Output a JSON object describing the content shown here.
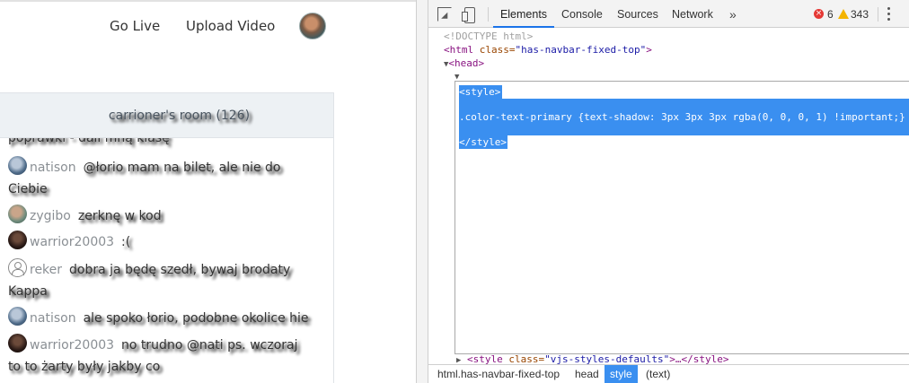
{
  "page": {
    "nav": {
      "go_live": "Go Live",
      "upload_video": "Upload Video"
    },
    "chat": {
      "title": "carrioner's room (126)",
      "cut_text": "poprawki - dali mną klasę",
      "messages": [
        {
          "user": "natison",
          "avatar": "photo",
          "text": "@łorio mam na bilet, ale nie do",
          "wrap": "Ciebie"
        },
        {
          "user": "zygibo",
          "avatar": "photo2",
          "text": "zerknę w kod",
          "wrap": ""
        },
        {
          "user": "warrior20003",
          "avatar": "dark",
          "text": ":(",
          "wrap": ""
        },
        {
          "user": "reker",
          "avatar": "default",
          "text": "dobra ja będę szedł, bywaj brodaty",
          "wrap": "Kappa"
        },
        {
          "user": "natison",
          "avatar": "photo",
          "text": "ale spoko łorio, podobne okolice hie",
          "wrap": ""
        },
        {
          "user": "warrior20003",
          "avatar": "dark",
          "text": "no trudno @nati ps. wczoraj",
          "wrap": "to to żarty były jakby co"
        }
      ]
    }
  },
  "devtools": {
    "tabs": {
      "elements": "Elements",
      "console": "Console",
      "sources": "Sources",
      "network": "Network",
      "more": "»"
    },
    "errors": "6",
    "warnings": "343",
    "dom": {
      "doctype": "<!DOCTYPE html>",
      "html_open_tag": "<html ",
      "html_attr": "class=",
      "html_val": "\"has-navbar-fixed-top\"",
      "html_close": ">",
      "head_open": "<head>",
      "style_open": "<style>",
      "style_rule": ".color-text-primary {text-shadow: 3px 3px 3px rgba(0, 0, 0, 1) !important;}",
      "style_close": "</style>",
      "style2_open": "<style ",
      "style2_attr": "class=",
      "style2_val": "\"vjs-styles-defaults\"",
      "style2_rest": ">…</style>"
    },
    "breadcrumbs": {
      "html": "html.has-navbar-fixed-top",
      "head": "head",
      "style": "style",
      "text": "(text)"
    }
  }
}
